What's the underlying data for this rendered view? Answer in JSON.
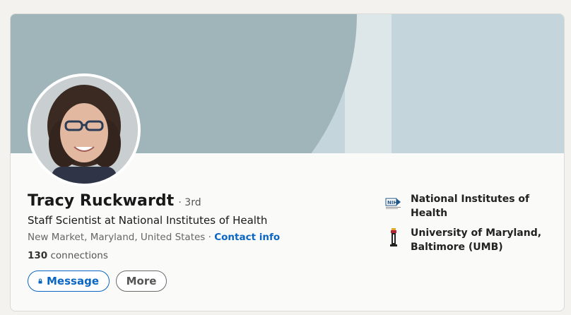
{
  "profile": {
    "name": "Tracy Ruckwardt",
    "degree": "· 3rd",
    "headline": "Staff Scientist at National Institutes of Health",
    "location": "New Market, Maryland, United States",
    "separator": " · ",
    "contact_info": "Contact info",
    "connections_count": "130",
    "connections_label": " connections"
  },
  "actions": {
    "message_label": "Message",
    "more_label": "More"
  },
  "organizations": [
    {
      "name": "National Institutes of Health",
      "logo": "nih-logo"
    },
    {
      "name": "University of Maryland, Baltimore (UMB)",
      "logo": "umb-logo"
    }
  ],
  "colors": {
    "accent": "#0a66c2",
    "banner_light": "#c4d6dc",
    "banner_dark": "#9fb5ba"
  }
}
